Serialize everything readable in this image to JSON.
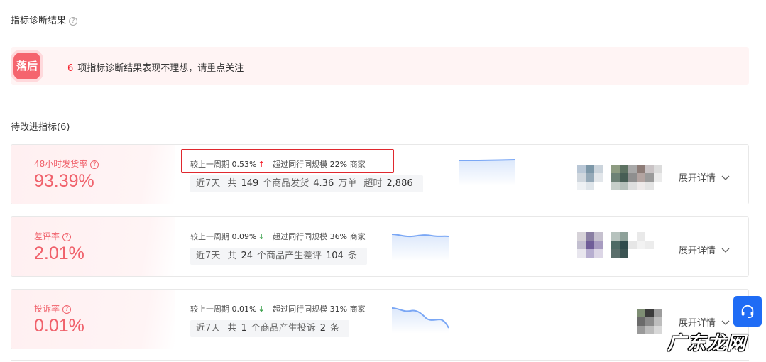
{
  "header": {
    "title": "指标诊断结果",
    "help": "?"
  },
  "banner": {
    "badge": "落后",
    "count": "6",
    "text": "项指标诊断结果表现不理想，请重点关注"
  },
  "pending": {
    "title": "待改进指标(6)"
  },
  "metrics": [
    {
      "name": "48小时发货率",
      "value": "93.39%",
      "compare_label": "较上一周期",
      "compare_value": "0.53%",
      "trend": "up",
      "exceed_label": "超过同行同规模",
      "exceed_value": "22%",
      "exceed_suffix": "商家",
      "period": "近7天",
      "s1": "共",
      "n1": "149",
      "s2": "个商品发货",
      "n2": "4.36",
      "s3": "万单",
      "s4": "超时",
      "n3": "2,886",
      "expand": "展开详情"
    },
    {
      "name": "差评率",
      "value": "2.01%",
      "compare_label": "较上一周期",
      "compare_value": "0.09%",
      "trend": "down",
      "exceed_label": "超过同行同规模",
      "exceed_value": "36%",
      "exceed_suffix": "商家",
      "period": "近7天",
      "s1": "共",
      "n1": "24",
      "s2": "个商品产生差评",
      "n2": "104",
      "s3": "条",
      "expand": "展开详情"
    },
    {
      "name": "投诉率",
      "value": "0.01%",
      "compare_label": "较上一周期",
      "compare_value": "0.01%",
      "trend": "down",
      "exceed_label": "超过同行同规模",
      "exceed_value": "31%",
      "exceed_suffix": "商家",
      "period": "近7天",
      "s1": "共",
      "n1": "1",
      "s2": "个商品产生投诉",
      "n2": "2",
      "s3": "条",
      "expand": "展开详情"
    }
  ],
  "icons": {
    "trend_up": "↑",
    "trend_down": "↓",
    "chevron": "chevron-down-icon",
    "support": "headset-icon"
  },
  "colors": {
    "accent_red": "#f0616b",
    "up": "#f5222d",
    "down": "#3aa04a",
    "support_blue": "#1f6cf5",
    "spark": "#7aa7f5"
  },
  "watermark": "广东龙网"
}
